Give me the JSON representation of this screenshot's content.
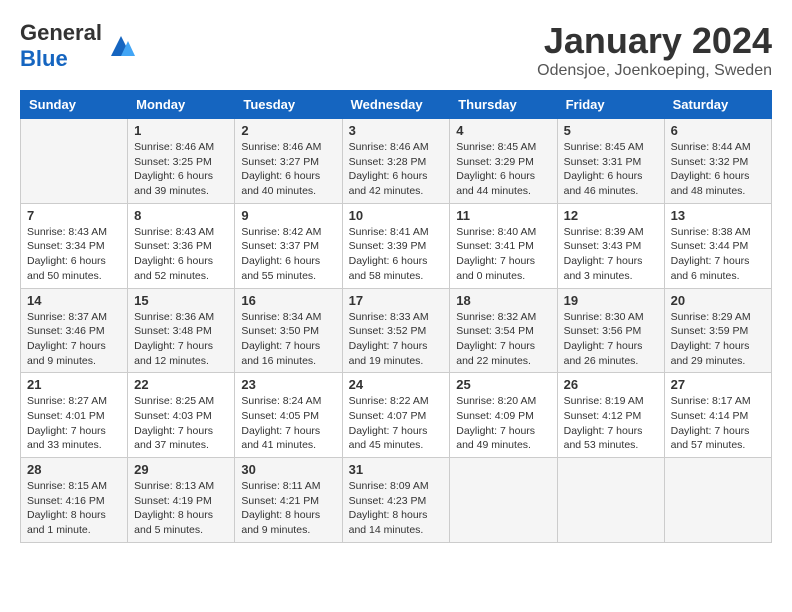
{
  "logo": {
    "text_general": "General",
    "text_blue": "Blue"
  },
  "title": "January 2024",
  "subtitle": "Odensjoe, Joenkoeping, Sweden",
  "days_of_week": [
    "Sunday",
    "Monday",
    "Tuesday",
    "Wednesday",
    "Thursday",
    "Friday",
    "Saturday"
  ],
  "weeks": [
    [
      {
        "day": "",
        "sunrise": "",
        "sunset": "",
        "daylight": ""
      },
      {
        "day": "1",
        "sunrise": "Sunrise: 8:46 AM",
        "sunset": "Sunset: 3:25 PM",
        "daylight": "Daylight: 6 hours and 39 minutes."
      },
      {
        "day": "2",
        "sunrise": "Sunrise: 8:46 AM",
        "sunset": "Sunset: 3:27 PM",
        "daylight": "Daylight: 6 hours and 40 minutes."
      },
      {
        "day": "3",
        "sunrise": "Sunrise: 8:46 AM",
        "sunset": "Sunset: 3:28 PM",
        "daylight": "Daylight: 6 hours and 42 minutes."
      },
      {
        "day": "4",
        "sunrise": "Sunrise: 8:45 AM",
        "sunset": "Sunset: 3:29 PM",
        "daylight": "Daylight: 6 hours and 44 minutes."
      },
      {
        "day": "5",
        "sunrise": "Sunrise: 8:45 AM",
        "sunset": "Sunset: 3:31 PM",
        "daylight": "Daylight: 6 hours and 46 minutes."
      },
      {
        "day": "6",
        "sunrise": "Sunrise: 8:44 AM",
        "sunset": "Sunset: 3:32 PM",
        "daylight": "Daylight: 6 hours and 48 minutes."
      }
    ],
    [
      {
        "day": "7",
        "sunrise": "Sunrise: 8:43 AM",
        "sunset": "Sunset: 3:34 PM",
        "daylight": "Daylight: 6 hours and 50 minutes."
      },
      {
        "day": "8",
        "sunrise": "Sunrise: 8:43 AM",
        "sunset": "Sunset: 3:36 PM",
        "daylight": "Daylight: 6 hours and 52 minutes."
      },
      {
        "day": "9",
        "sunrise": "Sunrise: 8:42 AM",
        "sunset": "Sunset: 3:37 PM",
        "daylight": "Daylight: 6 hours and 55 minutes."
      },
      {
        "day": "10",
        "sunrise": "Sunrise: 8:41 AM",
        "sunset": "Sunset: 3:39 PM",
        "daylight": "Daylight: 6 hours and 58 minutes."
      },
      {
        "day": "11",
        "sunrise": "Sunrise: 8:40 AM",
        "sunset": "Sunset: 3:41 PM",
        "daylight": "Daylight: 7 hours and 0 minutes."
      },
      {
        "day": "12",
        "sunrise": "Sunrise: 8:39 AM",
        "sunset": "Sunset: 3:43 PM",
        "daylight": "Daylight: 7 hours and 3 minutes."
      },
      {
        "day": "13",
        "sunrise": "Sunrise: 8:38 AM",
        "sunset": "Sunset: 3:44 PM",
        "daylight": "Daylight: 7 hours and 6 minutes."
      }
    ],
    [
      {
        "day": "14",
        "sunrise": "Sunrise: 8:37 AM",
        "sunset": "Sunset: 3:46 PM",
        "daylight": "Daylight: 7 hours and 9 minutes."
      },
      {
        "day": "15",
        "sunrise": "Sunrise: 8:36 AM",
        "sunset": "Sunset: 3:48 PM",
        "daylight": "Daylight: 7 hours and 12 minutes."
      },
      {
        "day": "16",
        "sunrise": "Sunrise: 8:34 AM",
        "sunset": "Sunset: 3:50 PM",
        "daylight": "Daylight: 7 hours and 16 minutes."
      },
      {
        "day": "17",
        "sunrise": "Sunrise: 8:33 AM",
        "sunset": "Sunset: 3:52 PM",
        "daylight": "Daylight: 7 hours and 19 minutes."
      },
      {
        "day": "18",
        "sunrise": "Sunrise: 8:32 AM",
        "sunset": "Sunset: 3:54 PM",
        "daylight": "Daylight: 7 hours and 22 minutes."
      },
      {
        "day": "19",
        "sunrise": "Sunrise: 8:30 AM",
        "sunset": "Sunset: 3:56 PM",
        "daylight": "Daylight: 7 hours and 26 minutes."
      },
      {
        "day": "20",
        "sunrise": "Sunrise: 8:29 AM",
        "sunset": "Sunset: 3:59 PM",
        "daylight": "Daylight: 7 hours and 29 minutes."
      }
    ],
    [
      {
        "day": "21",
        "sunrise": "Sunrise: 8:27 AM",
        "sunset": "Sunset: 4:01 PM",
        "daylight": "Daylight: 7 hours and 33 minutes."
      },
      {
        "day": "22",
        "sunrise": "Sunrise: 8:25 AM",
        "sunset": "Sunset: 4:03 PM",
        "daylight": "Daylight: 7 hours and 37 minutes."
      },
      {
        "day": "23",
        "sunrise": "Sunrise: 8:24 AM",
        "sunset": "Sunset: 4:05 PM",
        "daylight": "Daylight: 7 hours and 41 minutes."
      },
      {
        "day": "24",
        "sunrise": "Sunrise: 8:22 AM",
        "sunset": "Sunset: 4:07 PM",
        "daylight": "Daylight: 7 hours and 45 minutes."
      },
      {
        "day": "25",
        "sunrise": "Sunrise: 8:20 AM",
        "sunset": "Sunset: 4:09 PM",
        "daylight": "Daylight: 7 hours and 49 minutes."
      },
      {
        "day": "26",
        "sunrise": "Sunrise: 8:19 AM",
        "sunset": "Sunset: 4:12 PM",
        "daylight": "Daylight: 7 hours and 53 minutes."
      },
      {
        "day": "27",
        "sunrise": "Sunrise: 8:17 AM",
        "sunset": "Sunset: 4:14 PM",
        "daylight": "Daylight: 7 hours and 57 minutes."
      }
    ],
    [
      {
        "day": "28",
        "sunrise": "Sunrise: 8:15 AM",
        "sunset": "Sunset: 4:16 PM",
        "daylight": "Daylight: 8 hours and 1 minute."
      },
      {
        "day": "29",
        "sunrise": "Sunrise: 8:13 AM",
        "sunset": "Sunset: 4:19 PM",
        "daylight": "Daylight: 8 hours and 5 minutes."
      },
      {
        "day": "30",
        "sunrise": "Sunrise: 8:11 AM",
        "sunset": "Sunset: 4:21 PM",
        "daylight": "Daylight: 8 hours and 9 minutes."
      },
      {
        "day": "31",
        "sunrise": "Sunrise: 8:09 AM",
        "sunset": "Sunset: 4:23 PM",
        "daylight": "Daylight: 8 hours and 14 minutes."
      },
      {
        "day": "",
        "sunrise": "",
        "sunset": "",
        "daylight": ""
      },
      {
        "day": "",
        "sunrise": "",
        "sunset": "",
        "daylight": ""
      },
      {
        "day": "",
        "sunrise": "",
        "sunset": "",
        "daylight": ""
      }
    ]
  ]
}
